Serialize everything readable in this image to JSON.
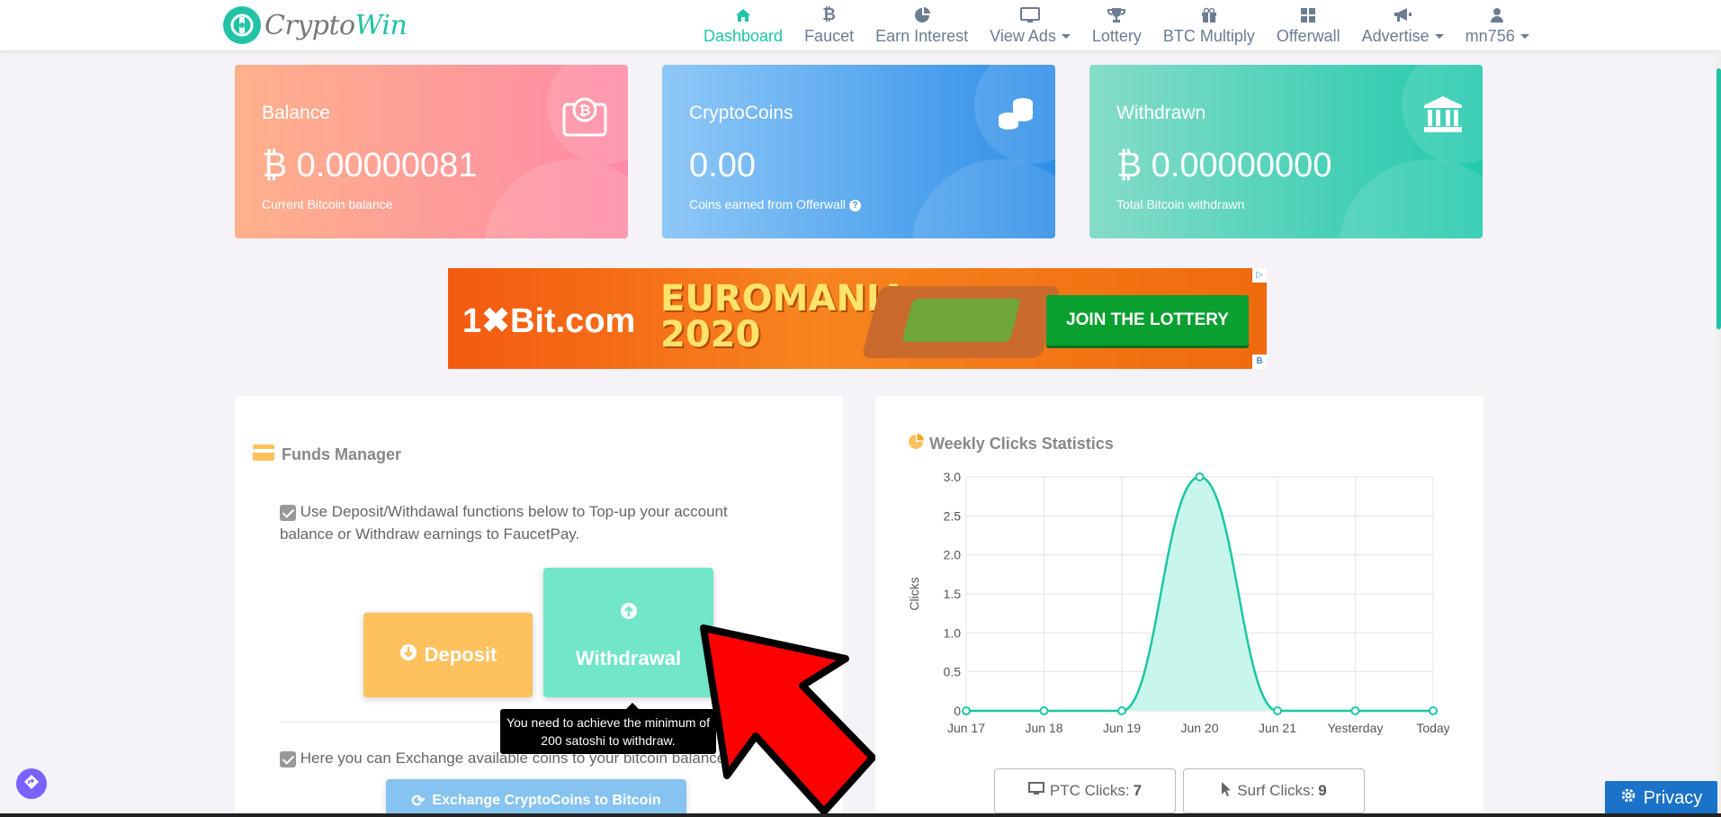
{
  "brand": {
    "name_left": "Crypto",
    "name_right": "Win"
  },
  "nav": {
    "items": [
      {
        "label": "Dashboard",
        "icon": "home-icon",
        "active": true
      },
      {
        "label": "Faucet",
        "icon": "bitcoin-icon"
      },
      {
        "label": "Earn Interest",
        "icon": "pie-chart-icon"
      },
      {
        "label": "View Ads",
        "icon": "monitor-icon",
        "dropdown": true
      },
      {
        "label": "Lottery",
        "icon": "trophy-icon"
      },
      {
        "label": "BTC Multiply",
        "icon": "gift-icon"
      },
      {
        "label": "Offerwall",
        "icon": "grid-icon"
      },
      {
        "label": "Advertise",
        "icon": "megaphone-icon",
        "dropdown": true
      },
      {
        "label": "mn756",
        "icon": "user-icon",
        "dropdown": true
      }
    ]
  },
  "cards": {
    "balance": {
      "label": "Balance",
      "value": "₿ 0.00000081",
      "sub": "Current Bitcoin balance"
    },
    "coins": {
      "label": "CryptoCoins",
      "value": "0.00",
      "sub": "Coins earned from Offerwall"
    },
    "withdrawn": {
      "label": "Withdrawn",
      "value": "₿ 0.00000000",
      "sub": "Total Bitcoin withdrawn"
    }
  },
  "banner": {
    "brand": "1✖Bit.com",
    "promo_line1": "EUROMANIA",
    "promo_line2": "2020",
    "cta": "JOIN THE LOTTERY"
  },
  "funds": {
    "title": "Funds Manager",
    "info_1": "Use Deposit/Withdawal functions below to Top-up your account balance or Withdraw earnings to FaucetPay.",
    "deposit_label": "Deposit",
    "withdraw_label": "Withdrawal",
    "tooltip": "You need to achieve the minimum of 200 satoshi to withdraw.",
    "info_2": "Here you can Exchange available coins to your bitcoin balance.",
    "exchange_label": "Exchange CryptoCoins to Bitcoin"
  },
  "stats": {
    "title": "Weekly Clicks Statistics",
    "ptc_label": "PTC Clicks:",
    "ptc_value": "7",
    "surf_label": "Surf Clicks:",
    "surf_value": "9"
  },
  "chart_data": {
    "type": "line",
    "categories": [
      "Jun 17",
      "Jun 18",
      "Jun 19",
      "Jun 20",
      "Jun 21",
      "Yesterday",
      "Today"
    ],
    "values": [
      0,
      0,
      0,
      3,
      0,
      0,
      0
    ],
    "ylabel": "Clicks",
    "ylim": [
      0,
      3
    ],
    "yticks": [
      "0",
      "0.5",
      "1.0",
      "1.5",
      "2.0",
      "2.5",
      "3.0"
    ],
    "grid": true,
    "fill": true,
    "color": "#1cc6a6",
    "fill_color": "#c9f6ec"
  },
  "privacy": {
    "label": "Privacy"
  },
  "colors": {
    "accent": "#1cc6a6",
    "deposit": "#fdc15e",
    "withdraw": "#72e6c9",
    "exchange": "#86c3f0"
  }
}
